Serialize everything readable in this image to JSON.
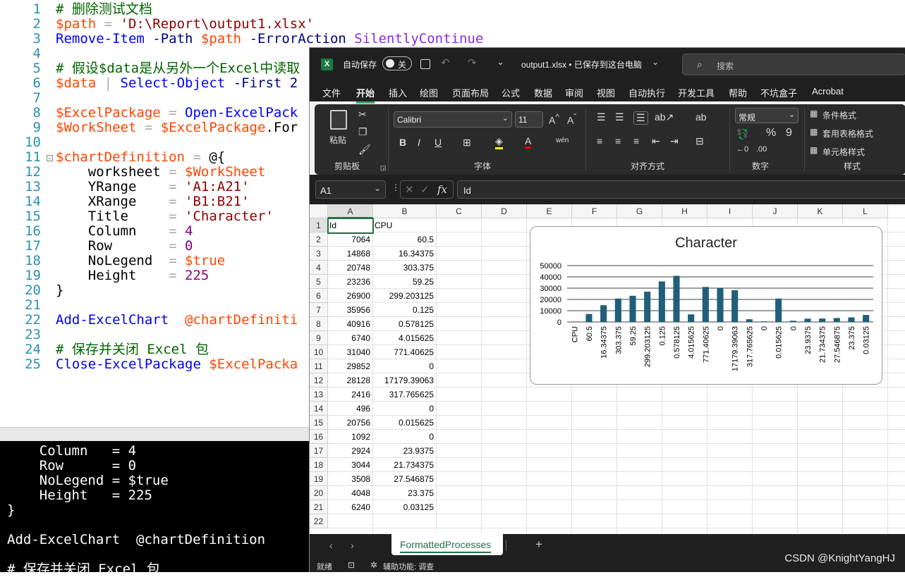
{
  "editor": {
    "lines": [
      {
        "n": "1",
        "parts": [
          [
            "# 删除测试文档",
            "c-com"
          ]
        ]
      },
      {
        "n": "2",
        "parts": [
          [
            "$path",
            "c-var"
          ],
          [
            " = ",
            "c-op"
          ],
          [
            "'D:\\Report\\output1.xlsx'",
            "c-str"
          ]
        ]
      },
      {
        "n": "3",
        "parts": [
          [
            "Remove-Item",
            "c-cmd"
          ],
          [
            " -Path ",
            "c-par"
          ],
          [
            "$path",
            "c-var"
          ],
          [
            " -ErrorAction ",
            "c-par"
          ],
          [
            "SilentlyContinue",
            "c-pl"
          ]
        ]
      },
      {
        "n": "4",
        "parts": []
      },
      {
        "n": "5",
        "parts": [
          [
            "# 假设$data是从另外一个Excel中读取",
            "c-com"
          ]
        ]
      },
      {
        "n": "6",
        "parts": [
          [
            "$data",
            "c-var"
          ],
          [
            " | ",
            "c-op"
          ],
          [
            "Select-Object",
            "c-cmd"
          ],
          [
            " -First 2",
            "c-par"
          ]
        ]
      },
      {
        "n": "7",
        "parts": []
      },
      {
        "n": "8",
        "parts": [
          [
            "$ExcelPackage",
            "c-var"
          ],
          [
            " = ",
            "c-op"
          ],
          [
            "Open-ExcelPack",
            "c-cmd"
          ]
        ]
      },
      {
        "n": "9",
        "parts": [
          [
            "$WorkSheet",
            "c-var"
          ],
          [
            " = ",
            "c-op"
          ],
          [
            "$ExcelPackage",
            "c-var"
          ],
          [
            ".For",
            "c-blk"
          ]
        ]
      },
      {
        "n": "10",
        "parts": []
      },
      {
        "n": "11",
        "parts": [
          [
            "$chartDefinition",
            "c-var"
          ],
          [
            " = ",
            "c-op"
          ],
          [
            "@{",
            "c-blk"
          ]
        ]
      },
      {
        "n": "12",
        "parts": [
          [
            "    worksheet ",
            "c-blk"
          ],
          [
            "= ",
            "c-op"
          ],
          [
            "$WorkSheet",
            "c-var"
          ]
        ]
      },
      {
        "n": "13",
        "parts": [
          [
            "    YRange    ",
            "c-blk"
          ],
          [
            "= ",
            "c-op"
          ],
          [
            "'A1:A21'",
            "c-str"
          ]
        ]
      },
      {
        "n": "14",
        "parts": [
          [
            "    XRange    ",
            "c-blk"
          ],
          [
            "= ",
            "c-op"
          ],
          [
            "'B1:B21'",
            "c-str"
          ]
        ]
      },
      {
        "n": "15",
        "parts": [
          [
            "    Title     ",
            "c-blk"
          ],
          [
            "= ",
            "c-op"
          ],
          [
            "'Character'",
            "c-str"
          ]
        ]
      },
      {
        "n": "16",
        "parts": [
          [
            "    Column    ",
            "c-blk"
          ],
          [
            "= ",
            "c-op"
          ],
          [
            "4",
            "c-num"
          ]
        ]
      },
      {
        "n": "17",
        "parts": [
          [
            "    Row       ",
            "c-blk"
          ],
          [
            "= ",
            "c-op"
          ],
          [
            "0",
            "c-num"
          ]
        ]
      },
      {
        "n": "18",
        "parts": [
          [
            "    NoLegend  ",
            "c-blk"
          ],
          [
            "= ",
            "c-op"
          ],
          [
            "$true",
            "c-var"
          ]
        ]
      },
      {
        "n": "19",
        "parts": [
          [
            "    Height    ",
            "c-blk"
          ],
          [
            "= ",
            "c-op"
          ],
          [
            "225",
            "c-num"
          ]
        ]
      },
      {
        "n": "20",
        "parts": [
          [
            "}",
            "c-blk"
          ]
        ]
      },
      {
        "n": "21",
        "parts": []
      },
      {
        "n": "22",
        "parts": [
          [
            "Add-ExcelChart",
            "c-cmd"
          ],
          [
            "  @chartDefiniti",
            "c-var"
          ]
        ]
      },
      {
        "n": "23",
        "parts": []
      },
      {
        "n": "24",
        "parts": [
          [
            "# 保存并关闭 Excel 包",
            "c-com"
          ]
        ]
      },
      {
        "n": "25",
        "parts": [
          [
            "Close-ExcelPackage",
            "c-cmd"
          ],
          [
            " $ExcelPacka",
            "c-var"
          ]
        ]
      }
    ]
  },
  "console": {
    "lines": [
      "    Column   = 4",
      "    Row      = 0",
      "    NoLegend = $true",
      "    Height   = 225",
      "}",
      "",
      "Add-ExcelChart  @chartDefinition",
      "",
      "# 保存并关闭 Excel 包"
    ]
  },
  "excel": {
    "autosave_label": "自动保存",
    "autosave_state": "关",
    "filename": "output1.xlsx • 已保存到这台电脑",
    "search_placeholder": "搜索",
    "tabs": [
      "文件",
      "开始",
      "插入",
      "绘图",
      "页面布局",
      "公式",
      "数据",
      "审阅",
      "视图",
      "自动执行",
      "开发工具",
      "帮助",
      "不坑盒子",
      "Acrobat"
    ],
    "active_tab": "开始",
    "clipboard": {
      "paste": "粘贴",
      "group": "剪贴板"
    },
    "font": {
      "name": "Calibri",
      "size": "11",
      "group": "字体",
      "bold": "B",
      "italic": "I",
      "underline": "U"
    },
    "align": {
      "group": "对齐方式"
    },
    "number": {
      "format": "常规",
      "group": "数字"
    },
    "styles": {
      "cond": "条件格式",
      "table": "套用表格格式",
      "cell": "单元格样式",
      "group": "样式"
    },
    "name_box": "A1",
    "formula_value": "Id",
    "columns": [
      "A",
      "B",
      "C",
      "D",
      "E",
      "F",
      "G",
      "H",
      "I",
      "J",
      "K",
      "L"
    ],
    "rows": [
      "1",
      "2",
      "3",
      "4",
      "5",
      "6",
      "7",
      "8",
      "9",
      "10",
      "11",
      "12",
      "13",
      "14",
      "15",
      "16",
      "17",
      "18",
      "19",
      "20",
      "21",
      "22"
    ],
    "cells": [
      [
        "Id",
        "CPU"
      ],
      [
        "7064",
        "60.5"
      ],
      [
        "14868",
        "16.34375"
      ],
      [
        "20748",
        "303.375"
      ],
      [
        "23236",
        "59.25"
      ],
      [
        "26900",
        "299.203125"
      ],
      [
        "35956",
        "0.125"
      ],
      [
        "40916",
        "0.578125"
      ],
      [
        "6740",
        "4.015625"
      ],
      [
        "31040",
        "771.40625"
      ],
      [
        "29852",
        "0"
      ],
      [
        "28128",
        "17179.39063"
      ],
      [
        "2416",
        "317.765625"
      ],
      [
        "496",
        "0"
      ],
      [
        "20756",
        "0.015625"
      ],
      [
        "1092",
        "0"
      ],
      [
        "2924",
        "23.9375"
      ],
      [
        "3044",
        "21.734375"
      ],
      [
        "3508",
        "27.546875"
      ],
      [
        "4048",
        "23.375"
      ],
      [
        "6240",
        "0.03125"
      ],
      [
        "",
        ""
      ]
    ],
    "sheet_tab": "FormattedProcesses",
    "add_sheet": "+",
    "status_ready": "就绪",
    "status_access": "辅助功能: 调查",
    "watermark": "CSDN @KnightYangHJ"
  },
  "chart_data": {
    "type": "bar",
    "title": "Character",
    "categories": [
      "CPU",
      "60.5",
      "16.34375",
      "303.375",
      "59.25",
      "299.203125",
      "0.125",
      "0.578125",
      "4.015625",
      "771.40625",
      "0",
      "17179.39063",
      "317.765625",
      "0",
      "0.015625",
      "0",
      "23.9375",
      "21.734375",
      "27.546875",
      "23.375",
      "0.03125"
    ],
    "values": [
      0,
      7064,
      14868,
      20748,
      23236,
      26900,
      35956,
      40916,
      6740,
      31040,
      29852,
      28128,
      2416,
      496,
      20756,
      1092,
      2924,
      3044,
      3508,
      4048,
      6240
    ],
    "ylim": [
      0,
      50000
    ],
    "yticks": [
      "50000",
      "40000",
      "30000",
      "20000",
      "10000",
      "0"
    ],
    "grid": true,
    "legend": "none",
    "bar_color": "#1f5f7a"
  }
}
